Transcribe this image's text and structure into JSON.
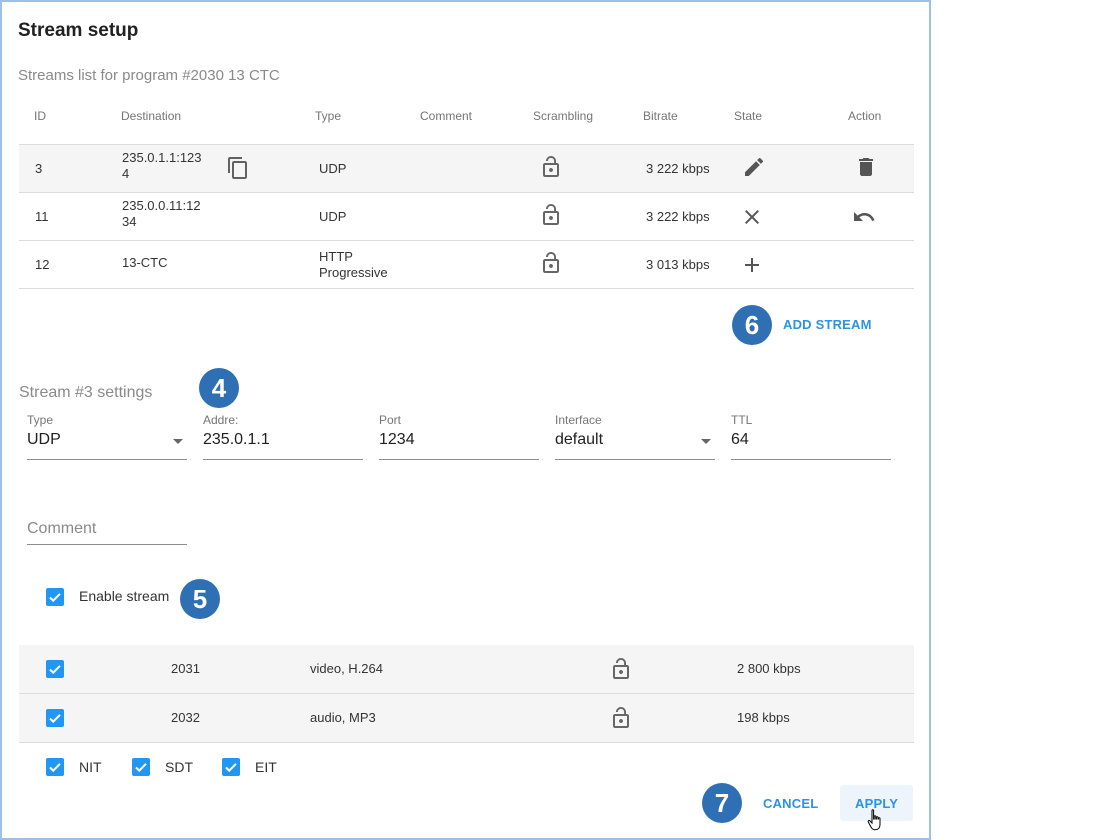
{
  "dialog": {
    "title": "Stream setup",
    "subtitle": "Streams list for program #2030 13 CTC"
  },
  "table": {
    "headers": [
      "ID",
      "Destination",
      "Type",
      "Comment",
      "Scrambling",
      "Bitrate",
      "State",
      "Action"
    ],
    "rows": [
      {
        "id": "3",
        "dest_line1": "235.0.1.1:123",
        "dest_line2": "4",
        "type_line1": "UDP",
        "type_line2": "",
        "bitrate": "3 222 kbps",
        "state_icon": "pencil-icon",
        "action_icon": "trash-icon"
      },
      {
        "id": "11",
        "dest_line1": "235.0.0.11:12",
        "dest_line2": "34",
        "type_line1": "UDP",
        "type_line2": "",
        "bitrate": "3 222 kbps",
        "state_icon": "close-icon",
        "action_icon": "undo-icon"
      },
      {
        "id": "12",
        "dest_line1": "13-CTC",
        "dest_line2": "",
        "type_line1": "HTTP",
        "type_line2": "Progressive",
        "bitrate": "3 013 kbps",
        "state_icon": "plus-icon",
        "action_icon": ""
      }
    ]
  },
  "add_stream_label": "ADD STREAM",
  "badges": {
    "b4": "4",
    "b5": "5",
    "b6": "6",
    "b7": "7"
  },
  "settings": {
    "title": "Stream #3 settings",
    "type": {
      "label": "Type",
      "value": "UDP"
    },
    "address": {
      "label": "Addre:",
      "value": "235.0.1.1"
    },
    "port": {
      "label": "Port",
      "value": "1234"
    },
    "interface": {
      "label": "Interface",
      "value": "default"
    },
    "ttl": {
      "label": "TTL",
      "value": "64"
    },
    "comment_placeholder": "Comment",
    "enable_label": "Enable stream"
  },
  "pids": [
    {
      "pid": "2031",
      "desc": "video, H.264",
      "bitrate": "2 800 kbps"
    },
    {
      "pid": "2032",
      "desc": "audio, MP3",
      "bitrate": "198 kbps"
    }
  ],
  "tables_checks": [
    "NIT",
    "SDT",
    "EIT"
  ],
  "buttons": {
    "cancel": "CANCEL",
    "apply": "APPLY"
  },
  "colors": {
    "accent": "#2196f3",
    "badge": "#2f6fb4",
    "link": "#2d93e0"
  }
}
